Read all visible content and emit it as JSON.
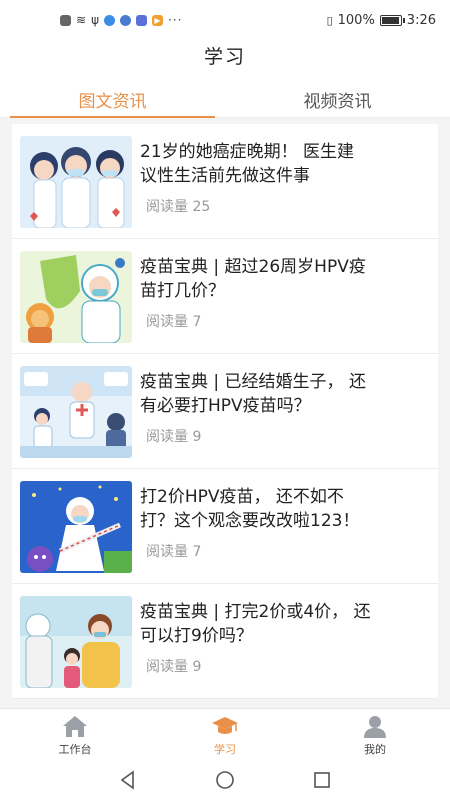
{
  "status_bar": {
    "battery": "100%",
    "battery_level": 1.0,
    "time": "3:26",
    "more": "···"
  },
  "header": {
    "title": "学习"
  },
  "tabs": [
    {
      "label": "图文资讯",
      "active": true
    },
    {
      "label": "视频资讯",
      "active": false
    }
  ],
  "articles": [
    {
      "title_line1": "21岁的她癌症晚期！ 医生建",
      "title_line2": "议性生活前先做这件事",
      "meta": "阅读量 25"
    },
    {
      "title_line1": "疫苗宝典 | 超过26周岁HPV疫",
      "title_line2": "苗打几价？",
      "meta": "阅读量 7"
    },
    {
      "title_line1": "疫苗宝典 | 已经结婚生子， 还",
      "title_line2": "有必要打HPV疫苗吗？",
      "meta": "阅读量 9"
    },
    {
      "title_line1": "打2价HPV疫苗， 还不如不",
      "title_line2": "打？这个观念要改改啦123！",
      "meta": "阅读量 7"
    },
    {
      "title_line1": "疫苗宝典 | 打完2价或4价， 还",
      "title_line2": "可以打9价吗？",
      "meta": "阅读量 9"
    }
  ],
  "bottom_nav": [
    {
      "label": "工作台",
      "icon": "home-icon",
      "active": false
    },
    {
      "label": "学习",
      "icon": "graduation-cap-icon",
      "active": true
    },
    {
      "label": "我的",
      "icon": "user-icon",
      "active": false
    }
  ],
  "colors": {
    "accent": "#e8904a",
    "background": "#f4f4f4",
    "text": "#222222",
    "muted": "#999999"
  }
}
